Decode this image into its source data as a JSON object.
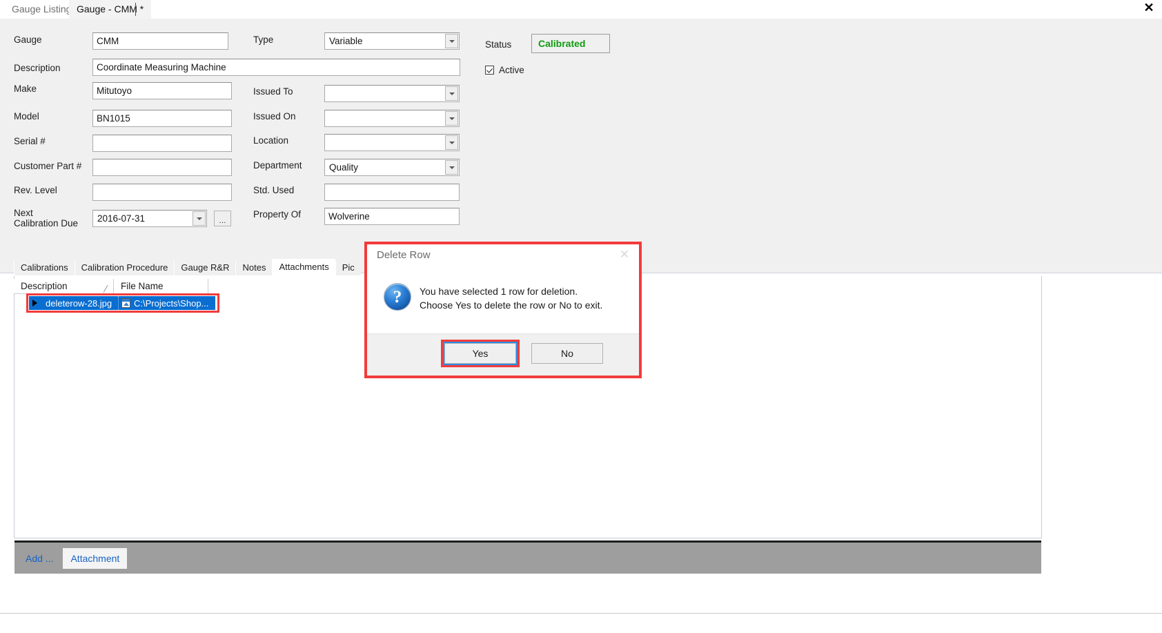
{
  "window": {
    "close_icon": "close-icon",
    "close_glyph": "✕"
  },
  "document_tabs": [
    {
      "label": "Gauge Listing",
      "active": false
    },
    {
      "label": "Gauge - CMM *",
      "active": true
    }
  ],
  "form": {
    "fields": [
      {
        "label": "Gauge",
        "value": "CMM"
      },
      {
        "label": "Description",
        "value": "Coordinate Measuring Machine"
      },
      {
        "label": "Make",
        "value": "Mitutoyo"
      },
      {
        "label": "Model",
        "value": "BN1015"
      },
      {
        "label": "Serial #",
        "value": ""
      },
      {
        "label": "Customer Part #",
        "value": ""
      },
      {
        "label": "Rev. Level",
        "value": ""
      },
      {
        "label": "Next\nCalibration Due",
        "value": "2016-07-31"
      }
    ],
    "right_fields": [
      {
        "label": "Type",
        "value": "Variable"
      },
      {
        "label": "Issued To",
        "value": ""
      },
      {
        "label": "Issued On",
        "value": ""
      },
      {
        "label": "Location",
        "value": ""
      },
      {
        "label": "Department",
        "value": "Quality"
      },
      {
        "label": "Std. Used",
        "value": ""
      },
      {
        "label": "Property Of",
        "value": "Wolverine"
      }
    ],
    "ellipsis_button_label": "...",
    "status": {
      "label": "Status",
      "value": "Calibrated",
      "color": "#0f9b0f"
    },
    "active_checkbox": {
      "label": "Active",
      "checked": true
    }
  },
  "lower_tabs": [
    {
      "label": "Calibrations",
      "active": false
    },
    {
      "label": "Calibration Procedure",
      "active": false
    },
    {
      "label": "Gauge R&R",
      "active": false
    },
    {
      "label": "Notes",
      "active": false
    },
    {
      "label": "Attachments",
      "active": true
    },
    {
      "label": "Pic",
      "active": false
    }
  ],
  "grid": {
    "columns": [
      {
        "label": "Description",
        "sort_glyph": "╱"
      },
      {
        "label": "File Name",
        "sort_glyph": ""
      }
    ],
    "rows": [
      {
        "description": "deleterow-28.jpg",
        "file_name": "C:\\Projects\\Shop...",
        "selected": true,
        "file_icon": "image-file-icon"
      }
    ]
  },
  "bottom_toolbar": {
    "add_link": "Add ...",
    "attachment_button": "Attachment"
  },
  "dialog": {
    "title": "Delete Row",
    "close_glyph": "✕",
    "icon": "question-mark-icon",
    "icon_glyph": "?",
    "message_line1": "You have selected 1 row for deletion.",
    "message_line2": "Choose Yes to delete the row or No to exit.",
    "buttons": {
      "yes": "Yes",
      "no": "No"
    }
  },
  "annotations": {
    "highlight_color": "#f23b3b",
    "focus_color": "#2f8ae0"
  }
}
